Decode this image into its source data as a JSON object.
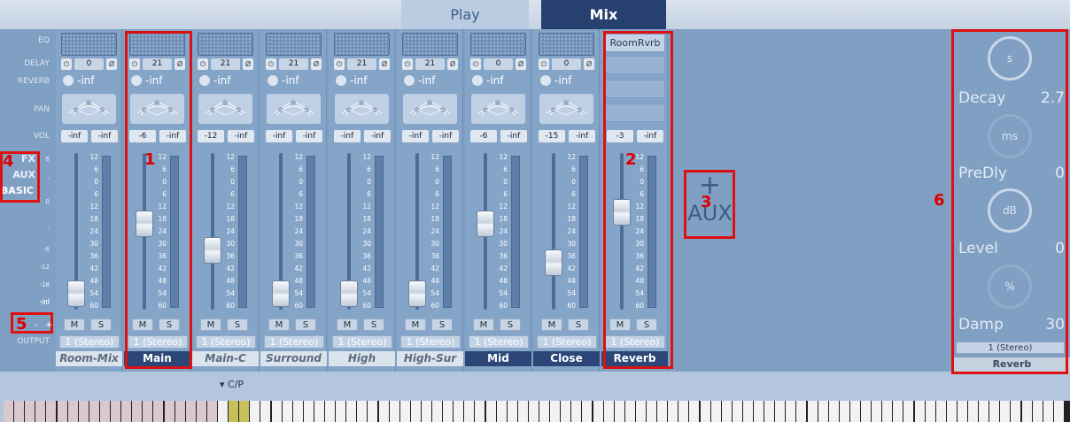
{
  "tabs": [
    {
      "label": "Play"
    },
    {
      "label": "Mix"
    }
  ],
  "row_labels": {
    "eq": "EQ",
    "delay": "DELAY",
    "reverb": "REVERB",
    "pan": "PAN",
    "vol": "VOL",
    "output": "OUTPUT"
  },
  "modes": [
    "FX",
    "AUX",
    "BASIC"
  ],
  "zoom": {
    "minus": "-",
    "plus": "+"
  },
  "left_scale": [
    "6",
    "-",
    "0",
    "-",
    "-6",
    "-12",
    "-18",
    "-30",
    "-inf"
  ],
  "fader_scale": [
    "12",
    "6",
    "0",
    "6",
    "12",
    "18",
    "24",
    "30",
    "36",
    "42",
    "48",
    "54",
    "60"
  ],
  "channels": [
    {
      "name": "Room-Mix",
      "delay": "0",
      "reverb": "-inf",
      "vol_l": "-inf",
      "vol_r": "-inf",
      "output": "1 (Stereo)",
      "fader_level": 0.1
    },
    {
      "name": "Main",
      "delay": "21",
      "reverb": "-inf",
      "vol_l": "-6",
      "vol_r": "-inf",
      "output": "1 (Stereo)",
      "fader_level": 0.55
    },
    {
      "name": "Main-C",
      "delay": "21",
      "reverb": "-inf",
      "vol_l": "-12",
      "vol_r": "-inf",
      "output": "1 (Stereo)",
      "fader_level": 0.38
    },
    {
      "name": "Surround",
      "delay": "21",
      "reverb": "-inf",
      "vol_l": "-inf",
      "vol_r": "-inf",
      "output": "1 (Stereo)",
      "fader_level": 0.1
    },
    {
      "name": "High",
      "delay": "21",
      "reverb": "-inf",
      "vol_l": "-inf",
      "vol_r": "-inf",
      "output": "1 (Stereo)",
      "fader_level": 0.1
    },
    {
      "name": "High-Sur",
      "delay": "21",
      "reverb": "-inf",
      "vol_l": "-inf",
      "vol_r": "-inf",
      "output": "1 (Stereo)",
      "fader_level": 0.1
    },
    {
      "name": "Mid",
      "delay": "0",
      "reverb": "-inf",
      "vol_l": "-6",
      "vol_r": "-inf",
      "output": "1 (Stereo)",
      "fader_level": 0.55
    },
    {
      "name": "Close",
      "delay": "0",
      "reverb": "-inf",
      "vol_l": "-15",
      "vol_r": "-inf",
      "output": "1 (Stereo)",
      "fader_level": 0.3
    }
  ],
  "aux": {
    "slot_name": "RoomRvrb",
    "vol_l": "-3",
    "vol_r": "-inf",
    "output": "1 (Stereo)",
    "name": "Reverb",
    "fader_level": 0.62
  },
  "add_aux": {
    "plus": "+",
    "label": "AUX"
  },
  "reverb_panel": {
    "dials": [
      "s",
      "ms",
      "dB",
      "%"
    ],
    "params": [
      {
        "label": "Decay",
        "value": "2.7"
      },
      {
        "label": "PreDly",
        "value": "0"
      },
      {
        "label": "Level",
        "value": "0"
      },
      {
        "label": "Damp",
        "value": "30"
      }
    ],
    "output": "1 (Stereo)",
    "name": "Reverb"
  },
  "keyboard": {
    "label": "C/P"
  },
  "annotations": [
    "1",
    "2",
    "3",
    "4",
    "5",
    "6"
  ]
}
